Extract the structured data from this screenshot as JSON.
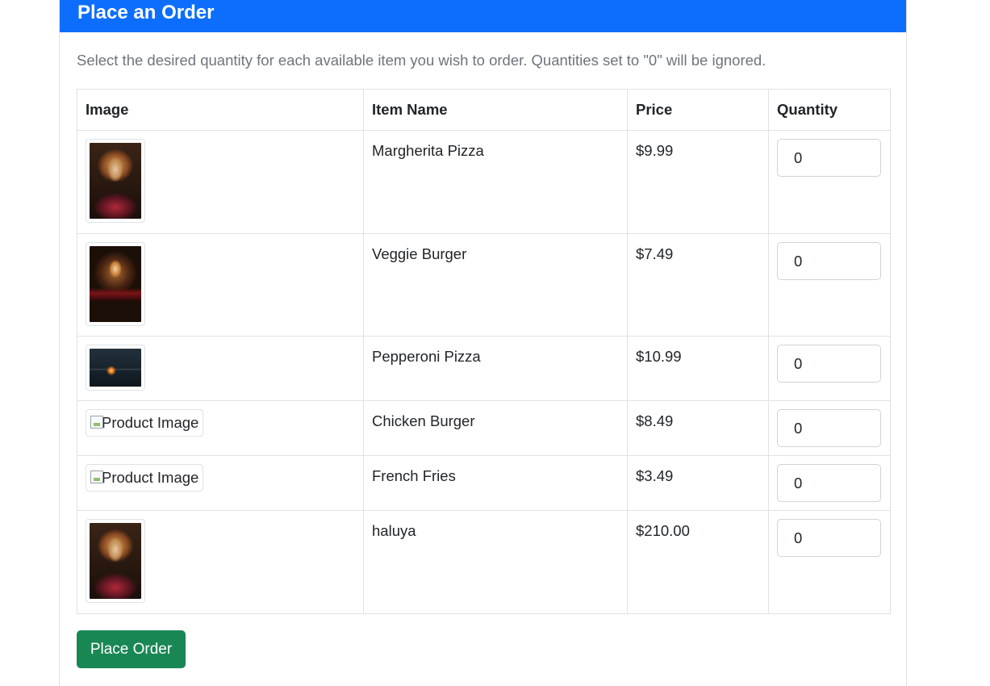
{
  "header": {
    "title": "Place an Order"
  },
  "intro": "Select the desired quantity for each available item you wish to order. Quantities set to \"0\" will be ignored.",
  "table": {
    "columns": [
      "Image",
      "Item Name",
      "Price",
      "Quantity"
    ],
    "rows": [
      {
        "image_alt": "",
        "name": "Margherita Pizza",
        "price": "$9.99",
        "quantity": "0"
      },
      {
        "image_alt": "",
        "name": "Veggie Burger",
        "price": "$7.49",
        "quantity": "0"
      },
      {
        "image_alt": "",
        "name": "Pepperoni Pizza",
        "price": "$10.99",
        "quantity": "0"
      },
      {
        "image_alt": "Product Image",
        "name": "Chicken Burger",
        "price": "$8.49",
        "quantity": "0"
      },
      {
        "image_alt": "Product Image",
        "name": "French Fries",
        "price": "$3.49",
        "quantity": "0"
      },
      {
        "image_alt": "",
        "name": "haluya",
        "price": "$210.00",
        "quantity": "0"
      }
    ]
  },
  "submit_label": "Place Order",
  "colors": {
    "header": "#0d6efd",
    "submit": "#198754",
    "muted": "#6c757d",
    "border": "#dee2e6"
  }
}
